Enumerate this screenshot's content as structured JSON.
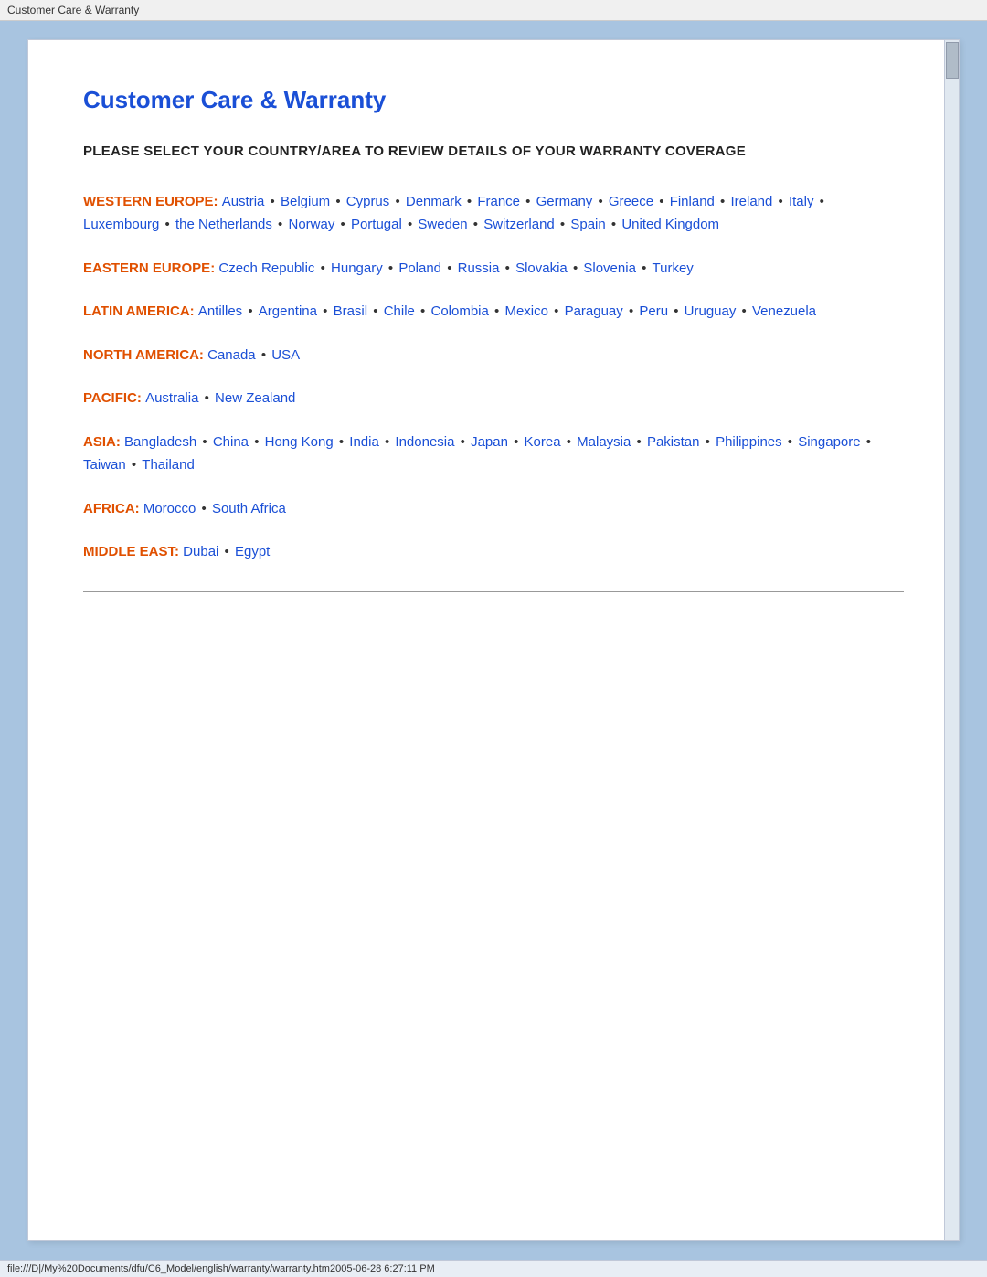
{
  "titleBar": {
    "text": "Customer Care & Warranty"
  },
  "page": {
    "title": "Customer Care & Warranty",
    "subtitle": "PLEASE SELECT YOUR COUNTRY/AREA TO REVIEW DETAILS OF YOUR WARRANTY COVERAGE"
  },
  "regions": [
    {
      "id": "western-europe",
      "label": "WESTERN EUROPE:",
      "countries": [
        "Austria",
        "Belgium",
        "Cyprus",
        "Denmark",
        "France",
        "Germany",
        "Greece",
        "Finland",
        "Ireland",
        "Italy",
        "Luxembourg",
        "the Netherlands",
        "Norway",
        "Portugal",
        "Sweden",
        "Switzerland",
        "Spain",
        "United Kingdom"
      ]
    },
    {
      "id": "eastern-europe",
      "label": "EASTERN EUROPE:",
      "countries": [
        "Czech Republic",
        "Hungary",
        "Poland",
        "Russia",
        "Slovakia",
        "Slovenia",
        "Turkey"
      ]
    },
    {
      "id": "latin-america",
      "label": "LATIN AMERICA:",
      "countries": [
        "Antilles",
        "Argentina",
        "Brasil",
        "Chile",
        "Colombia",
        "Mexico",
        "Paraguay",
        "Peru",
        "Uruguay",
        "Venezuela"
      ]
    },
    {
      "id": "north-america",
      "label": "NORTH AMERICA:",
      "countries": [
        "Canada",
        "USA"
      ]
    },
    {
      "id": "pacific",
      "label": "PACIFIC:",
      "countries": [
        "Australia",
        "New Zealand"
      ]
    },
    {
      "id": "asia",
      "label": "ASIA:",
      "countries": [
        "Bangladesh",
        "China",
        "Hong Kong",
        "India",
        "Indonesia",
        "Japan",
        "Korea",
        "Malaysia",
        "Pakistan",
        "Philippines",
        "Singapore",
        "Taiwan",
        "Thailand"
      ]
    },
    {
      "id": "africa",
      "label": "AFRICA:",
      "countries": [
        "Morocco",
        "South Africa"
      ]
    },
    {
      "id": "middle-east",
      "label": "MIDDLE EAST:",
      "countries": [
        "Dubai",
        "Egypt"
      ]
    }
  ],
  "statusBar": {
    "text": "file:///D|/My%20Documents/dfu/C6_Model/english/warranty/warranty.htm2005-06-28  6:27:11 PM"
  }
}
